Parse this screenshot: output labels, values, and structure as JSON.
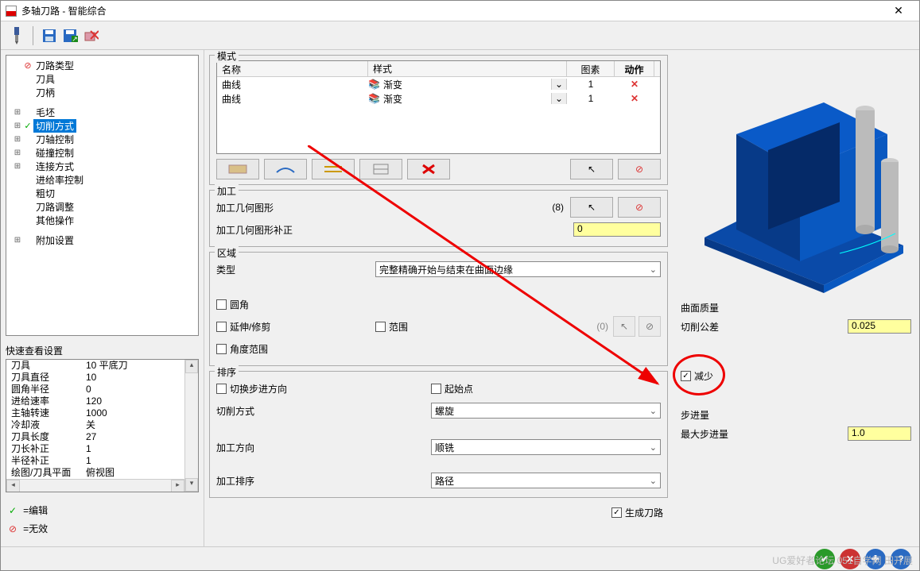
{
  "window": {
    "title": "多轴刀路 - 智能综合"
  },
  "tree": [
    {
      "mark": "red",
      "label": "刀路类型",
      "exp": ""
    },
    {
      "mark": "",
      "label": "刀具",
      "exp": ""
    },
    {
      "mark": "",
      "label": "刀柄",
      "exp": ""
    },
    {
      "mark": "",
      "label": "毛坯",
      "exp": "⊞"
    },
    {
      "mark": "green",
      "label": "切削方式",
      "exp": "⊞",
      "sel": true
    },
    {
      "mark": "",
      "label": "刀轴控制",
      "exp": "⊞"
    },
    {
      "mark": "",
      "label": "碰撞控制",
      "exp": "⊞"
    },
    {
      "mark": "",
      "label": "连接方式",
      "exp": "⊞"
    },
    {
      "mark": "",
      "label": "进给率控制",
      "exp": ""
    },
    {
      "mark": "",
      "label": "粗切",
      "exp": ""
    },
    {
      "mark": "",
      "label": "刀路调整",
      "exp": ""
    },
    {
      "mark": "",
      "label": "其他操作",
      "exp": ""
    },
    {
      "mark": "",
      "label": "附加设置",
      "exp": "⊞",
      "gap": true
    }
  ],
  "quickview": {
    "title": "快速查看设置",
    "rows": [
      {
        "k": "刀具",
        "v": "10 平底刀"
      },
      {
        "k": "刀具直径",
        "v": "10"
      },
      {
        "k": "圆角半径",
        "v": "0"
      },
      {
        "k": "进给速率",
        "v": "120"
      },
      {
        "k": "主轴转速",
        "v": "1000"
      },
      {
        "k": "冷却液",
        "v": "关"
      },
      {
        "k": "刀具长度",
        "v": "27"
      },
      {
        "k": "刀长补正",
        "v": "1"
      },
      {
        "k": "半径补正",
        "v": "1"
      },
      {
        "k": "绘图/刀具平面",
        "v": "俯视图"
      }
    ]
  },
  "legend": {
    "edit": "=编辑",
    "invalid": "=无效"
  },
  "mode": {
    "title": "模式",
    "headers": {
      "name": "名称",
      "style": "样式",
      "img": "图素",
      "act": "动作"
    },
    "rows": [
      {
        "name": "曲线",
        "style": "渐变",
        "img": "1",
        "act": "✕"
      },
      {
        "name": "曲线",
        "style": "渐变",
        "img": "1",
        "act": "✕"
      }
    ]
  },
  "machining": {
    "title": "加工",
    "geom_label": "加工几何图形",
    "geom_count": "(8)",
    "comp_label": "加工几何图形补正",
    "comp_value": "0"
  },
  "region": {
    "title": "区域",
    "type_label": "类型",
    "type_value": "完整精确开始与结束在曲面边缘",
    "fillet": "圆角",
    "extend": "延伸/修剪",
    "range": "范围",
    "range_count": "(0)",
    "anglerange": "角度范围"
  },
  "sort": {
    "title": "排序",
    "flip": "切换步进方向",
    "start": "起始点",
    "cut_label": "切削方式",
    "cut_value": "螺旋",
    "dir_label": "加工方向",
    "dir_value": "顺铣",
    "order_label": "加工排序",
    "order_value": "路径"
  },
  "gen_path": "生成刀路",
  "right": {
    "quality_title": "曲面质量",
    "tol_label": "切削公差",
    "tol_value": "0.025",
    "reduce": "减少",
    "step_title": "步进量",
    "maxstep_label": "最大步进量",
    "maxstep_value": "1.0"
  },
  "watermark": "UG爱好者论坛 051自学网 田开展"
}
